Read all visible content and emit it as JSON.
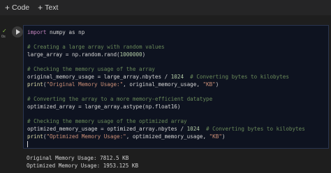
{
  "toolbar": {
    "code_label": "Code",
    "text_label": "Text"
  },
  "cell": {
    "exec_time": "0s",
    "code": [
      [
        {
          "t": "import",
          "c": "kw"
        },
        {
          "t": " numpy as np",
          "c": ""
        }
      ],
      [],
      [
        {
          "t": "# Creating a large array with random values",
          "c": "cm"
        }
      ],
      [
        {
          "t": "large_array = np.random.rand(",
          "c": ""
        },
        {
          "t": "1000000",
          "c": "nm"
        },
        {
          "t": ")",
          "c": ""
        }
      ],
      [],
      [
        {
          "t": "# Checking the memory usage of the array",
          "c": "cm"
        }
      ],
      [
        {
          "t": "original_memory_usage = large_array.nbytes / ",
          "c": ""
        },
        {
          "t": "1024",
          "c": "nm"
        },
        {
          "t": "  # Converting bytes to kilobytes",
          "c": "cm"
        }
      ],
      [
        {
          "t": "print",
          "c": "fn"
        },
        {
          "t": "(",
          "c": ""
        },
        {
          "t": "\"Original Memory Usage:\"",
          "c": "st"
        },
        {
          "t": ", original_memory_usage, ",
          "c": ""
        },
        {
          "t": "\"KB\"",
          "c": "st"
        },
        {
          "t": ")",
          "c": ""
        }
      ],
      [],
      [
        {
          "t": "# Converting the array to a more memory-efficient datatype",
          "c": "cm"
        }
      ],
      [
        {
          "t": "optimized_array = large_array.astype(np.float16)",
          "c": ""
        }
      ],
      [],
      [
        {
          "t": "# Checking the memory usage of the optimized array",
          "c": "cm"
        }
      ],
      [
        {
          "t": "optimized_memory_usage = optimized_array.nbytes / ",
          "c": ""
        },
        {
          "t": "1024",
          "c": "nm"
        },
        {
          "t": "  # Converting bytes to kilobytes",
          "c": "cm"
        }
      ],
      [
        {
          "t": "print",
          "c": "fn"
        },
        {
          "t": "(",
          "c": ""
        },
        {
          "t": "\"Optimized Memory Usage:\"",
          "c": "st"
        },
        {
          "t": ", optimized_memory_usage, ",
          "c": ""
        },
        {
          "t": "\"KB\"",
          "c": "st"
        },
        {
          "t": ")",
          "c": ""
        }
      ],
      []
    ]
  },
  "output": {
    "lines": [
      "Original Memory Usage: 7812.5 KB",
      "Optimized Memory Usage: 1953.125 KB"
    ]
  },
  "colors": {
    "background": "#1e1e1e",
    "editor_background": "#0e1320",
    "keyword": "#c586c0",
    "comment": "#6a8a5a",
    "string": "#ce9178",
    "number": "#b5cea8",
    "function": "#dcdcaa",
    "success_check": "#8bc34a"
  },
  "icons": {
    "run": "play-icon",
    "status": "check-icon"
  }
}
